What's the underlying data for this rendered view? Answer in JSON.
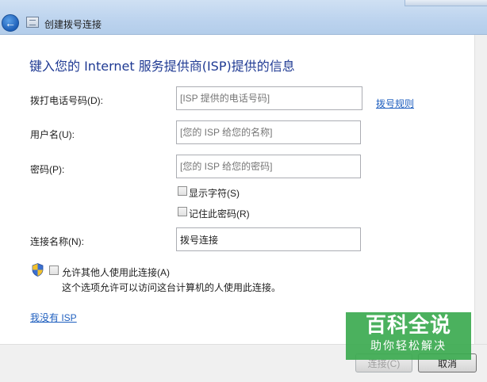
{
  "window": {
    "title": "创建拨号连接"
  },
  "heading": "键入您的 Internet 服务提供商(ISP)提供的信息",
  "fields": {
    "phone": {
      "label": "拨打电话号码(D):",
      "placeholder": "[ISP 提供的电话号码]",
      "value": ""
    },
    "username": {
      "label": "用户名(U):",
      "placeholder": "[您的 ISP 给您的名称]",
      "value": ""
    },
    "password": {
      "label": "密码(P):",
      "placeholder": "[您的 ISP 给您的密码]",
      "value": ""
    },
    "connection_name": {
      "label": "连接名称(N):",
      "value": "拨号连接"
    }
  },
  "links": {
    "dial_rules": "拨号规则",
    "no_isp": "我没有 ISP"
  },
  "checkboxes": {
    "show_chars": {
      "label": "显示字符(S)",
      "checked": false
    },
    "remember_password": {
      "label": "记住此密码(R)",
      "checked": false
    },
    "allow_others": {
      "label": "允许其他人使用此连接(A)",
      "checked": false
    }
  },
  "allow_others_description": "这个选项允许可以访问这台计算机的人使用此连接。",
  "buttons": {
    "connect": "连接(C)",
    "cancel": "取消"
  },
  "watermark": {
    "main": "百科全说",
    "sub": "助你轻松解决"
  },
  "colors": {
    "heading": "#1f3a93",
    "link": "#1f5fbf",
    "watermark": "#3caa50"
  }
}
